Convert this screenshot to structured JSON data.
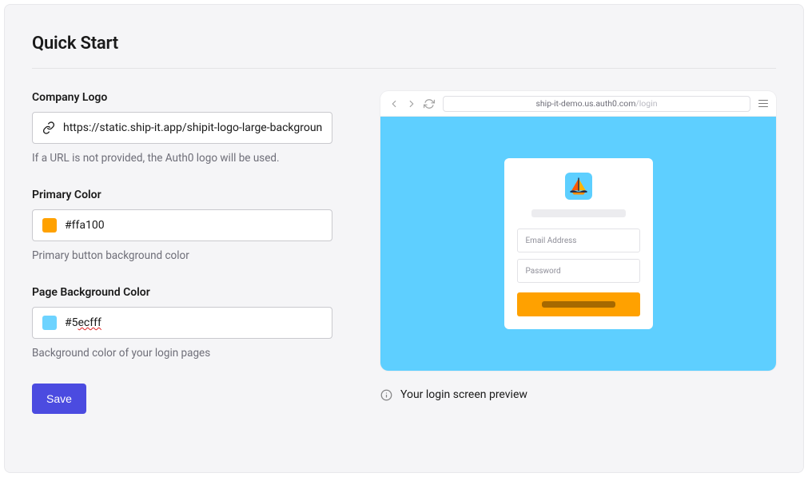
{
  "title": "Quick Start",
  "form": {
    "logo": {
      "label": "Company Logo",
      "value": "https://static.ship-it.app/shipit-logo-large-backgroun",
      "help": "If a URL is not provided, the Auth0 logo will be used."
    },
    "primary_color": {
      "label": "Primary Color",
      "value": "#ffa100",
      "swatch": "#ffa100",
      "help": "Primary button background color"
    },
    "bg_color": {
      "label": "Page Background Color",
      "value_prefix": "#5",
      "value_marked": "ecfff",
      "swatch": "#6dd3ff",
      "help": "Background color of your login pages"
    },
    "save_label": "Save"
  },
  "preview": {
    "url_host": "ship-it-demo.us.auth0.com",
    "url_path": "/login",
    "body_bg": "#5ecfff",
    "logo_bg": "#5dcfff",
    "email_placeholder": "Email Address",
    "password_placeholder": "Password",
    "button_bg": "#ffa100",
    "caption": "Your login screen preview"
  }
}
